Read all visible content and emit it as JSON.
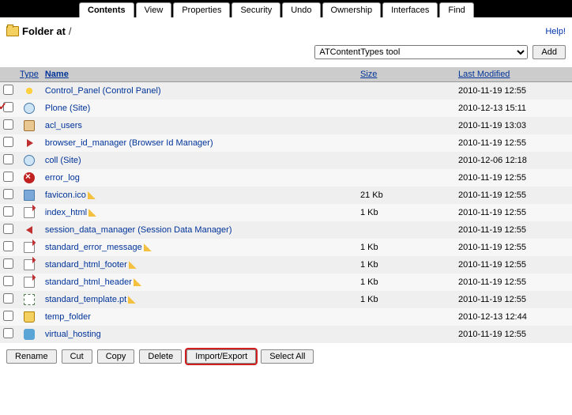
{
  "tabs": [
    "Contents",
    "View",
    "Properties",
    "Security",
    "Undo",
    "Ownership",
    "Interfaces",
    "Find"
  ],
  "active_tab": 0,
  "header": {
    "label": "Folder at",
    "path": "/",
    "help": "Help!"
  },
  "add": {
    "selected": "ATContentTypes tool",
    "button": "Add"
  },
  "columns": {
    "type": "Type",
    "name": "Name",
    "size": "Size",
    "modified": "Last Modified"
  },
  "rows": [
    {
      "flag": "",
      "icon": "gear",
      "name": "Control_Panel (Control Panel)",
      "pencil": false,
      "size": "",
      "date": "2010-11-19 12:55"
    },
    {
      "flag": "broken",
      "icon": "globe",
      "name": "Plone (Site)",
      "pencil": false,
      "size": "",
      "date": "2010-12-13 15:11"
    },
    {
      "flag": "",
      "icon": "users",
      "name": "acl_users",
      "pencil": false,
      "size": "",
      "date": "2010-11-19 13:03"
    },
    {
      "flag": "",
      "icon": "arr-r",
      "name": "browser_id_manager (Browser Id Manager)",
      "pencil": false,
      "size": "",
      "date": "2010-11-19 12:55"
    },
    {
      "flag": "",
      "icon": "globe",
      "name": "coll (Site)",
      "pencil": false,
      "size": "",
      "date": "2010-12-06 12:18"
    },
    {
      "flag": "",
      "icon": "error",
      "name": "error_log",
      "pencil": false,
      "size": "",
      "date": "2010-11-19 12:55"
    },
    {
      "flag": "",
      "icon": "img",
      "name": "favicon.ico",
      "pencil": true,
      "size": "21 Kb",
      "date": "2010-11-19 12:55"
    },
    {
      "flag": "",
      "icon": "doc",
      "name": "index_html",
      "pencil": true,
      "size": "1 Kb",
      "date": "2010-11-19 12:55"
    },
    {
      "flag": "",
      "icon": "arr-l",
      "name": "session_data_manager (Session Data Manager)",
      "pencil": false,
      "size": "",
      "date": "2010-11-19 12:55"
    },
    {
      "flag": "",
      "icon": "doc",
      "name": "standard_error_message",
      "pencil": true,
      "size": "1 Kb",
      "date": "2010-11-19 12:55"
    },
    {
      "flag": "",
      "icon": "doc",
      "name": "standard_html_footer",
      "pencil": true,
      "size": "1 Kb",
      "date": "2010-11-19 12:55"
    },
    {
      "flag": "",
      "icon": "doc",
      "name": "standard_html_header",
      "pencil": true,
      "size": "1 Kb",
      "date": "2010-11-19 12:55"
    },
    {
      "flag": "",
      "icon": "tmpl",
      "name": "standard_template.pt",
      "pencil": true,
      "size": "1 Kb",
      "date": "2010-11-19 12:55"
    },
    {
      "flag": "",
      "icon": "temp",
      "name": "temp_folder",
      "pencil": false,
      "size": "",
      "date": "2010-12-13 12:44"
    },
    {
      "flag": "",
      "icon": "vhost",
      "name": "virtual_hosting",
      "pencil": false,
      "size": "",
      "date": "2010-11-19 12:55"
    }
  ],
  "actions": {
    "rename": "Rename",
    "cut": "Cut",
    "copy": "Copy",
    "delete": "Delete",
    "import_export": "Import/Export",
    "select_all": "Select All"
  },
  "highlighted_action": "import_export"
}
